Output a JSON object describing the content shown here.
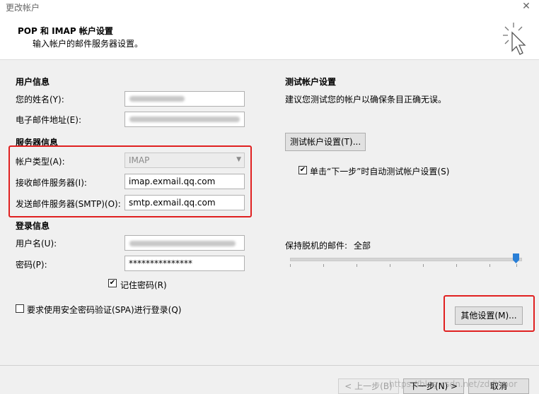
{
  "window": {
    "title": "更改帐户",
    "close_symbol": "✕"
  },
  "header": {
    "title": "POP 和 IMAP 帐户设置",
    "subtitle": "输入帐户的邮件服务器设置。"
  },
  "user_info": {
    "title": "用户信息",
    "name_label": "您的姓名(Y):",
    "email_label": "电子邮件地址(E):"
  },
  "server_info": {
    "title": "服务器信息",
    "account_type_label": "帐户类型(A):",
    "account_type_value": "IMAP",
    "incoming_label": "接收邮件服务器(I):",
    "incoming_value": "imap.exmail.qq.com",
    "outgoing_label": "发送邮件服务器(SMTP)(O):",
    "outgoing_value": "smtp.exmail.qq.com"
  },
  "login_info": {
    "title": "登录信息",
    "username_label": "用户名(U):",
    "password_label": "密码(P):",
    "password_value": "***************",
    "remember_label": "记住密码(R)",
    "remember_checked": "✔",
    "spa_label": "要求使用安全密码验证(SPA)进行登录(Q)"
  },
  "test_settings": {
    "title": "测试帐户设置",
    "desc": "建议您测试您的帐户以确保条目正确无误。",
    "test_button": "测试帐户设置(T)...",
    "auto_test_label": "单击“下一步”时自动测试帐户设置(S)",
    "auto_test_checked": "✔"
  },
  "offline": {
    "label": "保持脱机的邮件:",
    "value": "全部",
    "level_percent": 100
  },
  "more_settings_button": "其他设置(M)...",
  "footer": {
    "back_button": "< 上一步(B)",
    "next_button": "下一步(N) >",
    "cancel_button": "取消"
  },
  "watermark": "https://blog.csdn.net/zddYmor",
  "colors": {
    "highlight_box": "#e02020",
    "slider_thumb": "#2a7fd6"
  }
}
